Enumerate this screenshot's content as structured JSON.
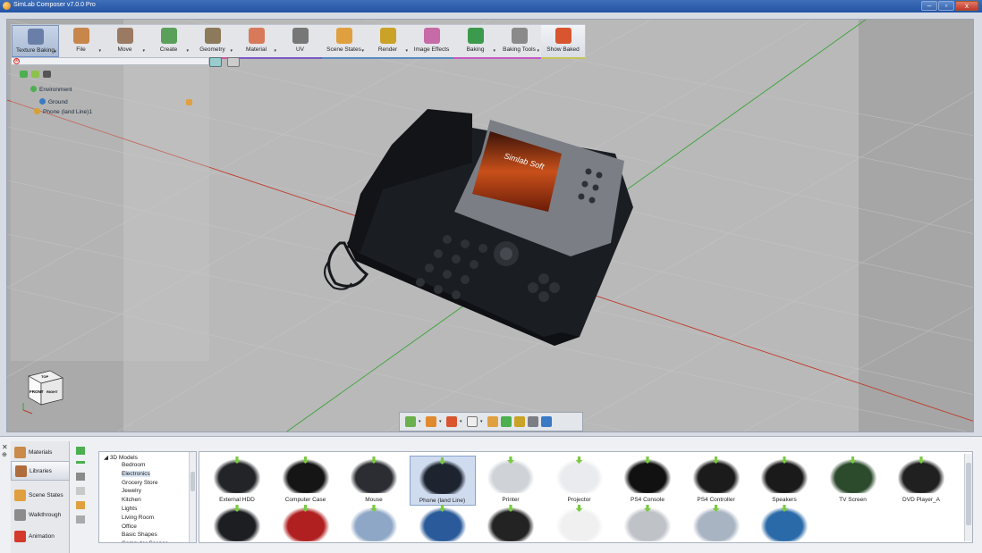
{
  "window": {
    "title": "SimLab Composer v7.0.0 Pro",
    "minimize": "–",
    "maximize": "▫",
    "close": "x"
  },
  "ribbon": [
    {
      "label": "Texture Baking",
      "dropdown": "▾",
      "color": "#6a7fa8",
      "stripe": "#6a8fd0"
    },
    {
      "label": "File",
      "dropdown": "▾",
      "color": "#c7864a",
      "stripe": "#6a8fd0"
    },
    {
      "label": "Move",
      "dropdown": "▾",
      "color": "#9b7a63",
      "stripe": "#c55a9a"
    },
    {
      "label": "Create",
      "dropdown": "▾",
      "color": "#5aa05a",
      "stripe": "#c55a9a"
    },
    {
      "label": "Geometry",
      "dropdown": "▾",
      "color": "#8d7a5a",
      "stripe": "#c55a9a"
    },
    {
      "label": "Material",
      "dropdown": "▾",
      "color": "#d87a5a",
      "stripe": "#7a5ac5"
    },
    {
      "label": "UV",
      "dropdown": "",
      "color": "#777777",
      "stripe": "#7a5ac5"
    },
    {
      "label": "Scene States",
      "dropdown": "▾",
      "color": "#e0a040",
      "stripe": "#5a8ac5"
    },
    {
      "label": "Render",
      "dropdown": "▾",
      "color": "#c9a227",
      "stripe": "#5a8ac5"
    },
    {
      "label": "Image Effects",
      "dropdown": "",
      "color": "#c76aa8",
      "stripe": "#5a8ac5"
    },
    {
      "label": "Baking",
      "dropdown": "▾",
      "color": "#3c9a4c",
      "stripe": "#c55ac5"
    },
    {
      "label": "Baking Tools",
      "dropdown": "▾",
      "color": "#8a8a8a",
      "stripe": "#c55ac5"
    },
    {
      "label": "Show Baked",
      "dropdown": "",
      "color": "#d8552f",
      "stripe": "#c5c55a"
    }
  ],
  "tree": {
    "clear_search": "⊗",
    "environment": "Environment",
    "ground": "Ground",
    "phone": "Phone (land Line)1"
  },
  "screen_text": "Simlab Soft",
  "navcube": {
    "top": "TOP",
    "front": "FRONT",
    "right": "RIGHT"
  },
  "panel": {
    "close": "✕",
    "pin": "⊕"
  },
  "side_nav": [
    {
      "label": "Materials",
      "color": "#c98a4a",
      "selected": false
    },
    {
      "label": "Libraries",
      "color": "#b06d3c",
      "selected": true
    },
    {
      "label": "Scene States",
      "color": "#e0a040",
      "selected": false
    },
    {
      "label": "Walkthrough",
      "color": "#8c8c8c",
      "selected": false
    },
    {
      "label": "Animation",
      "color": "#d33a2c",
      "selected": false
    }
  ],
  "categories": {
    "root": "3D Models",
    "items": [
      "Bedroom",
      "Electronics",
      "Grocery Store",
      "Jewelry",
      "Kitchen",
      "Lights",
      "Living Room",
      "Office",
      "Basic Shapes",
      "Computer Scenes"
    ],
    "selected": "Electronics"
  },
  "library": [
    {
      "name": "External HDD",
      "color": "#222428"
    },
    {
      "name": "Computer Case",
      "color": "#151515"
    },
    {
      "name": "Mouse",
      "color": "#2b2d33"
    },
    {
      "name": "Phone (land Line)",
      "color": "#1d2430",
      "selected": true
    },
    {
      "name": "Printer",
      "color": "#cfd3d8"
    },
    {
      "name": "Projector",
      "color": "#e9ebee"
    },
    {
      "name": "PS4 Console",
      "color": "#111111"
    },
    {
      "name": "PS4 Controller",
      "color": "#1b1b1b"
    },
    {
      "name": "Speakers",
      "color": "#1a1a1a"
    },
    {
      "name": "TV Screen",
      "color": "#2c4a2c"
    },
    {
      "name": "DVD Player_A",
      "color": "#202020"
    },
    {
      "name": "",
      "color": "#1c1e22"
    },
    {
      "name": "",
      "color": "#b02020"
    },
    {
      "name": "",
      "color": "#8ea7c6"
    },
    {
      "name": "",
      "color": "#2a5a9a"
    },
    {
      "name": "",
      "color": "#232323"
    },
    {
      "name": "",
      "color": "#f0f0f0"
    },
    {
      "name": "",
      "color": "#bfc3c8"
    },
    {
      "name": "",
      "color": "#a9b4c2"
    },
    {
      "name": "",
      "color": "#2a6aa8"
    }
  ]
}
